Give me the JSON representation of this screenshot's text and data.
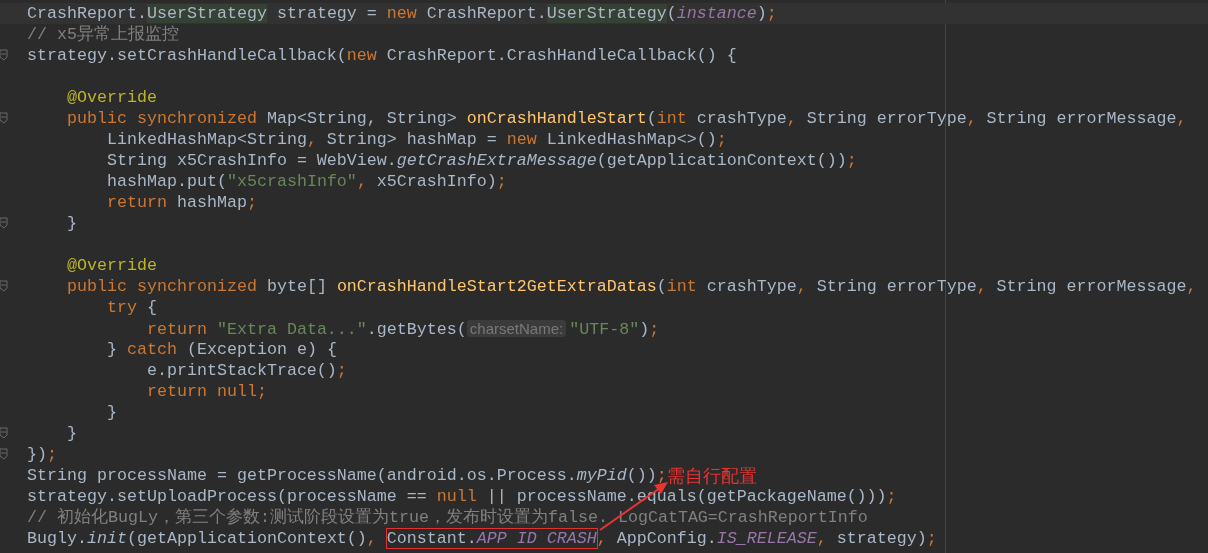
{
  "editor": {
    "lines": [
      {
        "current": true,
        "fold": false,
        "tokens": [
          {
            "kind": "plain",
            "text": "CrashReport."
          },
          {
            "kind": "type-highlight",
            "text": "UserStrategy"
          },
          {
            "kind": "plain",
            "text": " strategy = "
          },
          {
            "kind": "keyword",
            "text": "new"
          },
          {
            "kind": "plain",
            "text": " CrashReport."
          },
          {
            "kind": "type-highlight",
            "text": "UserStrategy"
          },
          {
            "kind": "plain",
            "text": "("
          },
          {
            "kind": "field",
            "text": "instance"
          },
          {
            "kind": "plain",
            "text": ")"
          },
          {
            "kind": "keyword",
            "text": ";"
          }
        ]
      },
      {
        "current": false,
        "fold": false,
        "tokens": [
          {
            "kind": "comment",
            "text": "// x5异常上报监控"
          }
        ]
      },
      {
        "current": false,
        "fold": true,
        "tokens": [
          {
            "kind": "plain",
            "text": "strategy.setCrashHandleCallback("
          },
          {
            "kind": "keyword",
            "text": "new"
          },
          {
            "kind": "plain",
            "text": " CrashReport.CrashHandleCallback() {"
          }
        ]
      },
      {
        "current": false,
        "fold": false
      },
      {
        "current": false,
        "fold": false,
        "tokens": [
          {
            "kind": "annotation",
            "text": "    @Override"
          }
        ]
      },
      {
        "current": false,
        "fold": true,
        "tokens": [
          {
            "kind": "keyword",
            "text": "    public synchronized"
          },
          {
            "kind": "plain",
            "text": " Map<String, String> "
          },
          {
            "kind": "method",
            "text": "onCrashHandleStart"
          },
          {
            "kind": "plain",
            "text": "("
          },
          {
            "kind": "keyword",
            "text": "int"
          },
          {
            "kind": "plain",
            "text": " crashType"
          },
          {
            "kind": "keyword",
            "text": ","
          },
          {
            "kind": "plain",
            "text": " String errorType"
          },
          {
            "kind": "keyword",
            "text": ","
          },
          {
            "kind": "plain",
            "text": " String errorMessage"
          },
          {
            "kind": "keyword",
            "text": ","
          }
        ]
      },
      {
        "current": false,
        "fold": false,
        "tokens": [
          {
            "kind": "plain",
            "text": "        LinkedHashMap<String"
          },
          {
            "kind": "keyword",
            "text": ","
          },
          {
            "kind": "plain",
            "text": " String> hashMap = "
          },
          {
            "kind": "keyword",
            "text": "new"
          },
          {
            "kind": "plain",
            "text": " LinkedHashMap<>()"
          },
          {
            "kind": "keyword",
            "text": ";"
          }
        ]
      },
      {
        "current": false,
        "fold": false,
        "tokens": [
          {
            "kind": "plain",
            "text": "        String x5CrashInfo = WebView."
          },
          {
            "kind": "italic",
            "text": "getCrashExtraMessage"
          },
          {
            "kind": "plain",
            "text": "(getApplicationContext())"
          },
          {
            "kind": "keyword",
            "text": ";"
          }
        ]
      },
      {
        "current": false,
        "fold": false,
        "tokens": [
          {
            "kind": "plain",
            "text": "        hashMap.put("
          },
          {
            "kind": "string",
            "text": "\"x5crashInfo\""
          },
          {
            "kind": "keyword",
            "text": ","
          },
          {
            "kind": "plain",
            "text": " x5CrashInfo)"
          },
          {
            "kind": "keyword",
            "text": ";"
          }
        ]
      },
      {
        "current": false,
        "fold": false,
        "tokens": [
          {
            "kind": "keyword",
            "text": "        return"
          },
          {
            "kind": "plain",
            "text": " hashMap"
          },
          {
            "kind": "keyword",
            "text": ";"
          }
        ]
      },
      {
        "current": false,
        "fold": true,
        "tokens": [
          {
            "kind": "plain",
            "text": "    }"
          }
        ]
      },
      {
        "current": false,
        "fold": false
      },
      {
        "current": false,
        "fold": false,
        "tokens": [
          {
            "kind": "annotation",
            "text": "    @Override"
          }
        ]
      },
      {
        "current": false,
        "fold": true,
        "tokens": [
          {
            "kind": "keyword",
            "text": "    public synchronized"
          },
          {
            "kind": "plain",
            "text": " byte[] "
          },
          {
            "kind": "method",
            "text": "onCrashHandleStart2GetExtraDatas"
          },
          {
            "kind": "plain",
            "text": "("
          },
          {
            "kind": "keyword",
            "text": "int"
          },
          {
            "kind": "plain",
            "text": " crashType"
          },
          {
            "kind": "keyword",
            "text": ","
          },
          {
            "kind": "plain",
            "text": " String errorType"
          },
          {
            "kind": "keyword",
            "text": ","
          },
          {
            "kind": "plain",
            "text": " String errorMessage"
          },
          {
            "kind": "keyword",
            "text": ","
          }
        ]
      },
      {
        "current": false,
        "fold": false,
        "tokens": [
          {
            "kind": "keyword",
            "text": "        try"
          },
          {
            "kind": "plain",
            "text": " {"
          }
        ]
      },
      {
        "current": false,
        "fold": false,
        "tokens": [
          {
            "kind": "keyword",
            "text": "            return "
          },
          {
            "kind": "string",
            "text": "\"Extra Data...\""
          },
          {
            "kind": "plain",
            "text": ".getBytes("
          },
          {
            "kind": "hint",
            "text": "charsetName:"
          },
          {
            "kind": "string",
            "text": "\"UTF-8\""
          },
          {
            "kind": "plain",
            "text": ")"
          },
          {
            "kind": "keyword",
            "text": ";"
          }
        ]
      },
      {
        "current": false,
        "fold": false,
        "tokens": [
          {
            "kind": "plain",
            "text": "        } "
          },
          {
            "kind": "keyword",
            "text": "catch"
          },
          {
            "kind": "plain",
            "text": " (Exception e) {"
          }
        ]
      },
      {
        "current": false,
        "fold": false,
        "tokens": [
          {
            "kind": "plain",
            "text": "            e.printStackTrace()"
          },
          {
            "kind": "keyword",
            "text": ";"
          }
        ]
      },
      {
        "current": false,
        "fold": false,
        "tokens": [
          {
            "kind": "keyword",
            "text": "            return null;"
          }
        ]
      },
      {
        "current": false,
        "fold": false,
        "tokens": [
          {
            "kind": "plain",
            "text": "        }"
          }
        ]
      },
      {
        "current": false,
        "fold": true,
        "tokens": [
          {
            "kind": "plain",
            "text": "    }"
          }
        ]
      },
      {
        "current": false,
        "fold": true,
        "tokens": [
          {
            "kind": "plain",
            "text": "})"
          },
          {
            "kind": "keyword",
            "text": ";"
          }
        ]
      },
      {
        "current": false,
        "fold": false,
        "note": "需自行配置",
        "tokens": [
          {
            "kind": "plain",
            "text": "String processName = getProcessName(android.os.Process."
          },
          {
            "kind": "italic",
            "text": "myPid"
          },
          {
            "kind": "plain",
            "text": "())"
          },
          {
            "kind": "keyword",
            "text": ";"
          }
        ]
      },
      {
        "current": false,
        "fold": false,
        "tokens": [
          {
            "kind": "plain",
            "text": "strategy.setUploadProcess(processName == "
          },
          {
            "kind": "keyword",
            "text": "null"
          },
          {
            "kind": "plain",
            "text": " || processName.equals(getPackageName()))"
          },
          {
            "kind": "keyword",
            "text": ";"
          }
        ]
      },
      {
        "current": false,
        "fold": false,
        "tokens": [
          {
            "kind": "comment",
            "text": "// 初始化BugLy，第三个参数:测试阶段设置为true，发布时设置为false. LogCatTAG=CrashReportInfo"
          }
        ]
      },
      {
        "current": false,
        "fold": false,
        "tokens": [
          {
            "kind": "plain",
            "text": "Bugly."
          },
          {
            "kind": "italic",
            "text": "init"
          },
          {
            "kind": "plain",
            "text": "(getApplicationContext()"
          },
          {
            "kind": "keyword",
            "text": ", "
          },
          {
            "kind": "red-box",
            "tokens": [
              {
                "kind": "plain",
                "text": "Constant."
              },
              {
                "kind": "field",
                "text": "APP ID CRASH"
              }
            ]
          },
          {
            "kind": "keyword",
            "text": ","
          },
          {
            "kind": "plain",
            "text": " AppConfig."
          },
          {
            "kind": "field",
            "text": "IS_RELEASE"
          },
          {
            "kind": "keyword",
            "text": ","
          },
          {
            "kind": "plain",
            "text": " strategy)"
          },
          {
            "kind": "keyword",
            "text": ";"
          }
        ]
      }
    ]
  }
}
